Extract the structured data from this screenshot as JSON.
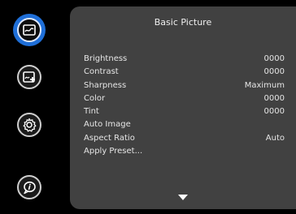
{
  "sidebar": {
    "buttons": [
      {
        "name": "picture-icon",
        "active": true
      },
      {
        "name": "advanced-settings-icon",
        "active": false
      },
      {
        "name": "gear-icon",
        "active": false
      },
      {
        "name": "info-icon",
        "active": false
      }
    ],
    "accent_color": "#1f6fd8"
  },
  "panel": {
    "title": "Basic Picture",
    "items": [
      {
        "label": "Brightness",
        "value": "0000"
      },
      {
        "label": "Contrast",
        "value": "0000"
      },
      {
        "label": "Sharpness",
        "value": "Maximum"
      },
      {
        "label": "Color",
        "value": "0000"
      },
      {
        "label": "Tint",
        "value": "0000"
      },
      {
        "label": "Auto Image",
        "value": ""
      },
      {
        "label": "Aspect Ratio",
        "value": "Auto"
      },
      {
        "label": "Apply Preset...",
        "value": ""
      }
    ],
    "scroll_indicator": "down-arrow-icon"
  }
}
